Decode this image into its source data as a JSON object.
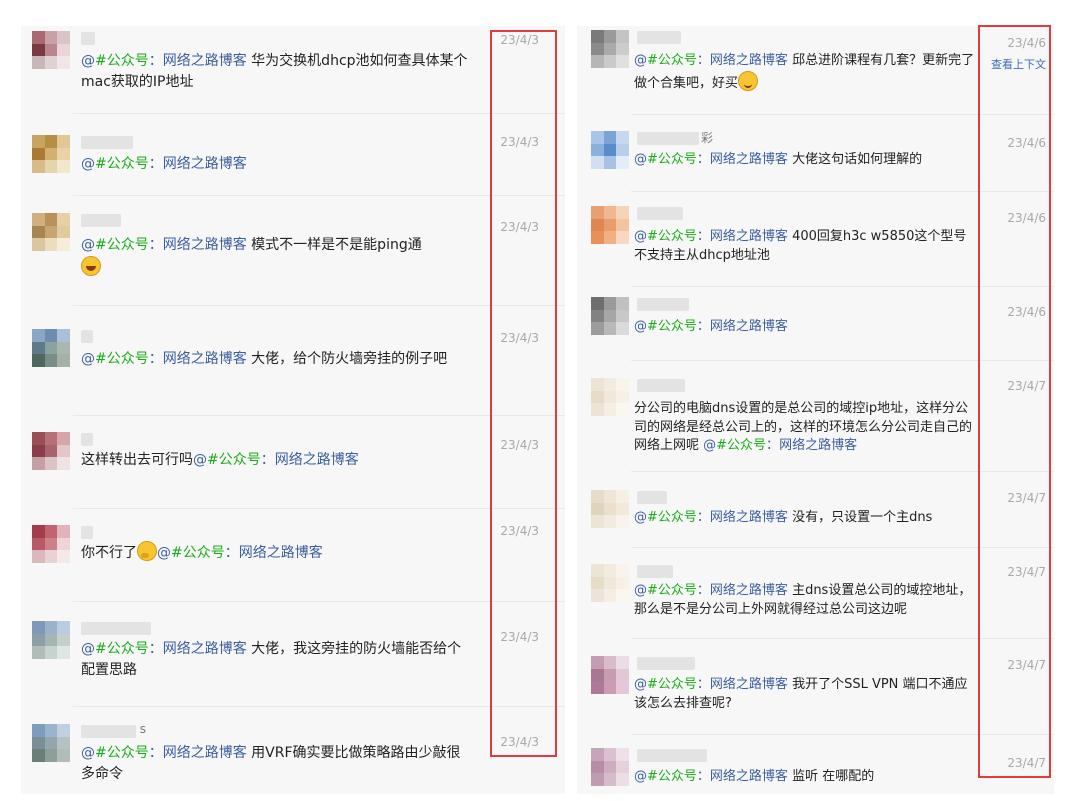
{
  "mention_prefix": "@",
  "mention_tag": "#公众号",
  "mention_sep": "：",
  "mention_name": "网络之路博客",
  "left_comments": [
    {
      "date": "23/4/3",
      "before": "",
      "after": " 华为交换机dhcp池如何查具体某个mac获取的IP地址"
    },
    {
      "date": "23/4/3",
      "before": "",
      "after": ""
    },
    {
      "date": "23/4/3",
      "before": "",
      "after": " 模式不一样是不是能ping通"
    },
    {
      "date": "23/4/3",
      "before": "",
      "after": " 大佬，给个防火墙旁挂的例子吧"
    },
    {
      "date": "23/4/3",
      "before": "这样转出去可行吗",
      "after": ""
    },
    {
      "date": "23/4/3",
      "before": "你不行了",
      "after": ""
    },
    {
      "date": "23/4/3",
      "before": "",
      "after": " 大佬，我这旁挂的防火墙能否给个配置思路"
    },
    {
      "date": "23/4/3",
      "before": "",
      "after": " 用VRF确实要比做策略路由少敲很多命令"
    }
  ],
  "right_comments": [
    {
      "date": "23/4/6",
      "before": "",
      "after": " 邱总进阶课程有几套？更新完了做个合集吧，好买"
    },
    {
      "date": "23/4/6",
      "before": "",
      "after": " 大佬这句话如何理解的"
    },
    {
      "date": "23/4/6",
      "before": "",
      "after": " 400回复h3c w5850这个型号不支持主从dhcp地址池"
    },
    {
      "date": "23/4/6",
      "before": "",
      "after": ""
    },
    {
      "date": "23/4/7",
      "before": "分公司的电脑dns设置的是总公司的域控ip地址，这样分公司的网络是经总公司上的，这样的环境怎么分公司走自己的网络上网呢   ",
      "after": ""
    },
    {
      "date": "23/4/7",
      "before": "",
      "after": " 没有，只设置一个主dns"
    },
    {
      "date": "23/4/7",
      "before": "",
      "after": " 主dns设置总公司的域控地址，那么是不是分公司上外网就得经过总公司这边呢"
    },
    {
      "date": "23/4/7",
      "before": "",
      "after": " 我开了个SSL VPN 端口不通应该怎么去排查呢?"
    },
    {
      "date": "23/4/7",
      "before": "",
      "after": " 监听 在哪配的"
    }
  ],
  "right_context_link": "查看上下文",
  "nickname_fragments": {
    "right_2": "彩",
    "left_8": "s"
  },
  "colors": {
    "mention_tag": "#1aad19",
    "mention_name": "#3b5f9e",
    "date": "#a8a8a8",
    "highlight_box": "#e23b3b"
  }
}
